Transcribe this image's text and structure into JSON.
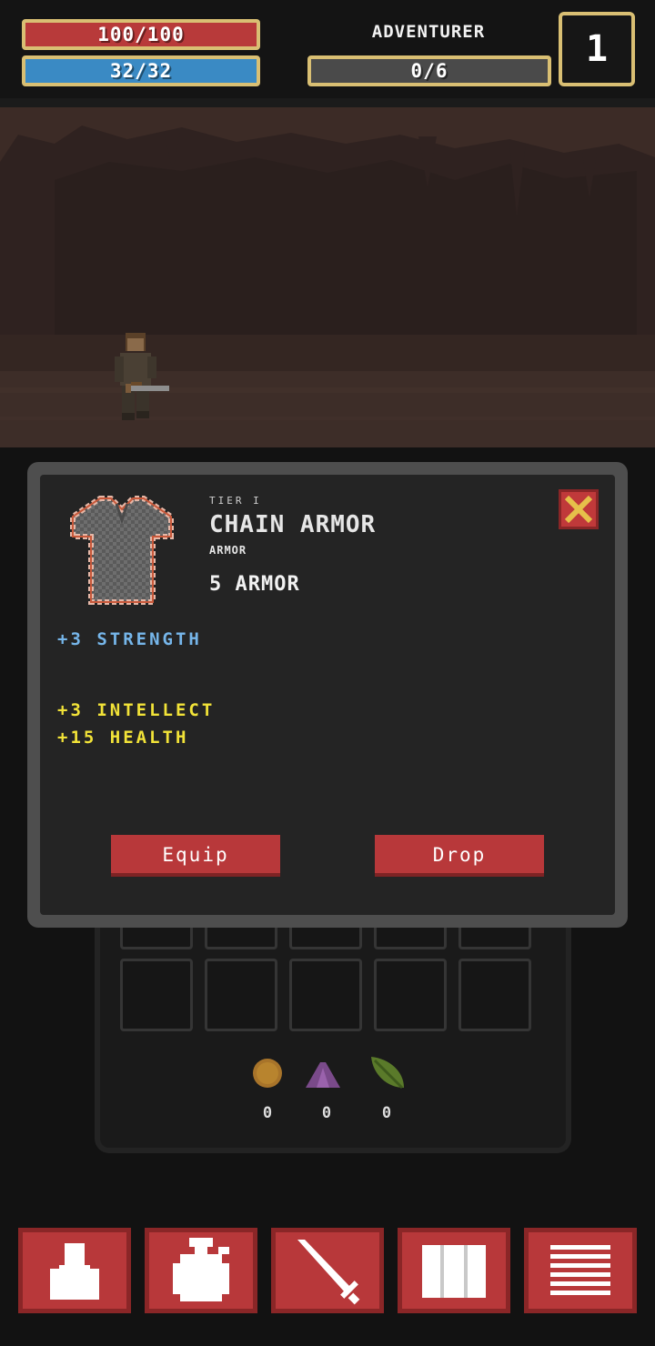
{
  "hud": {
    "health": "100/100",
    "mana": "32/32",
    "class_name": "ADVENTURER",
    "experience": "0/6",
    "level": "1"
  },
  "popup": {
    "tier": "TIER I",
    "name": "CHAIN ARMOR",
    "type": "ARMOR",
    "armor": "5 ARMOR",
    "stats": {
      "primary": "+3 STRENGTH",
      "secondary_1": "+3 INTELLECT",
      "secondary_2": "+15 HEALTH"
    },
    "equip_label": "Equip",
    "drop_label": "Drop",
    "item_icon": "chain-armor-shirt-icon",
    "close_icon": "close-x-icon"
  },
  "resources": {
    "gold": "0",
    "crystal": "0",
    "herb": "0"
  },
  "nav": {
    "items": [
      "character-icon",
      "bag-icon",
      "sword-icon",
      "map-book-icon",
      "menu-list-icon"
    ]
  },
  "colors": {
    "health": "#b83a3a",
    "mana": "#3a8ac4",
    "border_gold": "#d9bf73",
    "button_red": "#b8383a",
    "stat_blue": "#76b6ea",
    "stat_yellow": "#f2e338"
  }
}
